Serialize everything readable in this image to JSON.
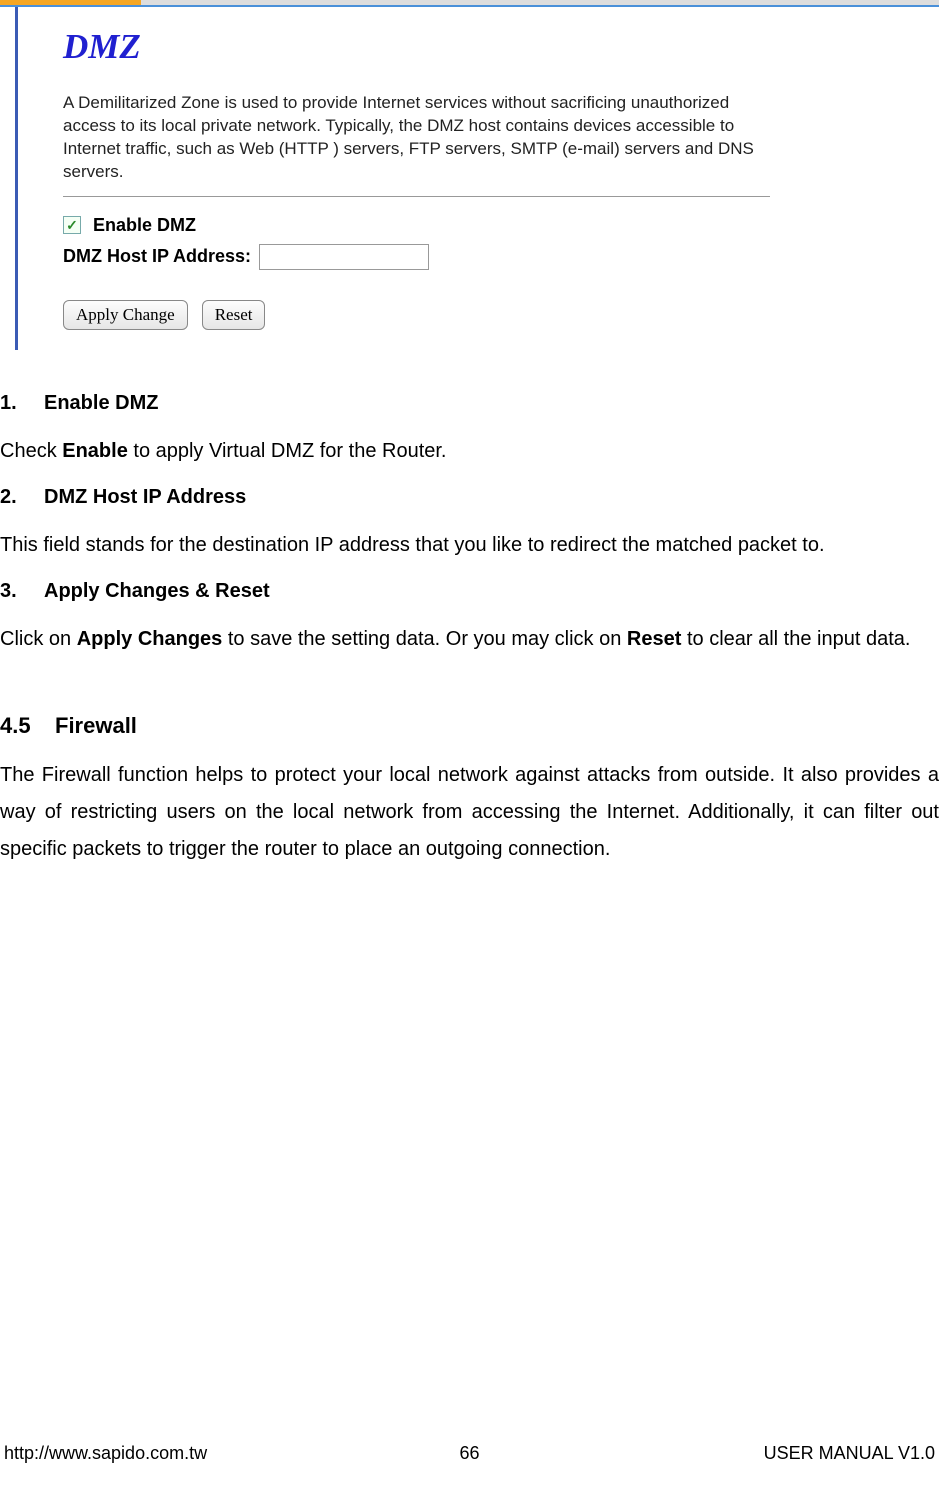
{
  "screenshot": {
    "title": "DMZ",
    "description": "A Demilitarized Zone is used to provide Internet services without sacrificing unauthorized access to its local private network. Typically, the DMZ host contains devices accessible to Internet traffic, such as Web (HTTP ) servers, FTP servers, SMTP (e-mail) servers and DNS servers.",
    "enable_checkbox_glyph": "✓",
    "enable_label": "Enable DMZ",
    "ip_label": "DMZ Host IP Address:",
    "ip_value": "",
    "apply_btn": "Apply Change",
    "reset_btn": "Reset"
  },
  "doc": {
    "h1_num": "1.",
    "h1_text": "Enable DMZ",
    "p1_a": "Check ",
    "p1_b": "Enable",
    "p1_c": " to apply Virtual DMZ for the Router.",
    "h2_num": "2.",
    "h2_text": "DMZ Host IP Address",
    "p2": "This field stands for the destination IP address that you like to redirect the matched packet to.",
    "h3_num": "3.",
    "h3_text": "Apply Changes & Reset",
    "p3_a": "Click on ",
    "p3_b": "Apply Changes",
    "p3_c": " to save the setting data. Or you may click on ",
    "p3_d": "Reset",
    "p3_e": " to clear all the input data.",
    "sec_num": "4.5",
    "sec_text": "Firewall",
    "sec_para": "The Firewall function helps to protect your local network against attacks from outside. It also provides a way of restricting users on the local network from accessing the Internet. Additionally, it can filter out specific packets to trigger the router to place an outgoing connection."
  },
  "footer": {
    "left": "http://www.sapido.com.tw",
    "page": "66",
    "right": "USER MANUAL V1.0"
  }
}
